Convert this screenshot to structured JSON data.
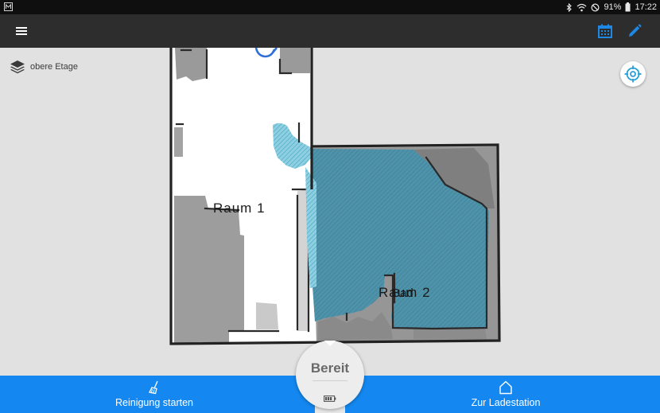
{
  "status_bar": {
    "battery": "91%",
    "time": "17:22",
    "icons": [
      "notification-icon",
      "bluetooth-icon",
      "wifi-icon",
      "mute-icon",
      "battery-icon"
    ]
  },
  "app_bar": {
    "icons": [
      "menu-icon",
      "calendar-icon",
      "edit-icon"
    ],
    "accent_color": "#1e88e5"
  },
  "map": {
    "floor_label": "obere Etage",
    "rooms": [
      {
        "label": "Raum 1",
        "selected": false
      },
      {
        "label": "Raum 2",
        "overlay_label": "Bad",
        "selected": true
      }
    ],
    "selected_room_color": "#4f93ab",
    "locate_icon": "crosshair-icon"
  },
  "bottom_bar": {
    "background": "#1488f0",
    "start_cleaning": "Reinigung starten",
    "go_to_dock": "Zur Ladestation"
  },
  "robot_status": {
    "text": "Bereit"
  }
}
